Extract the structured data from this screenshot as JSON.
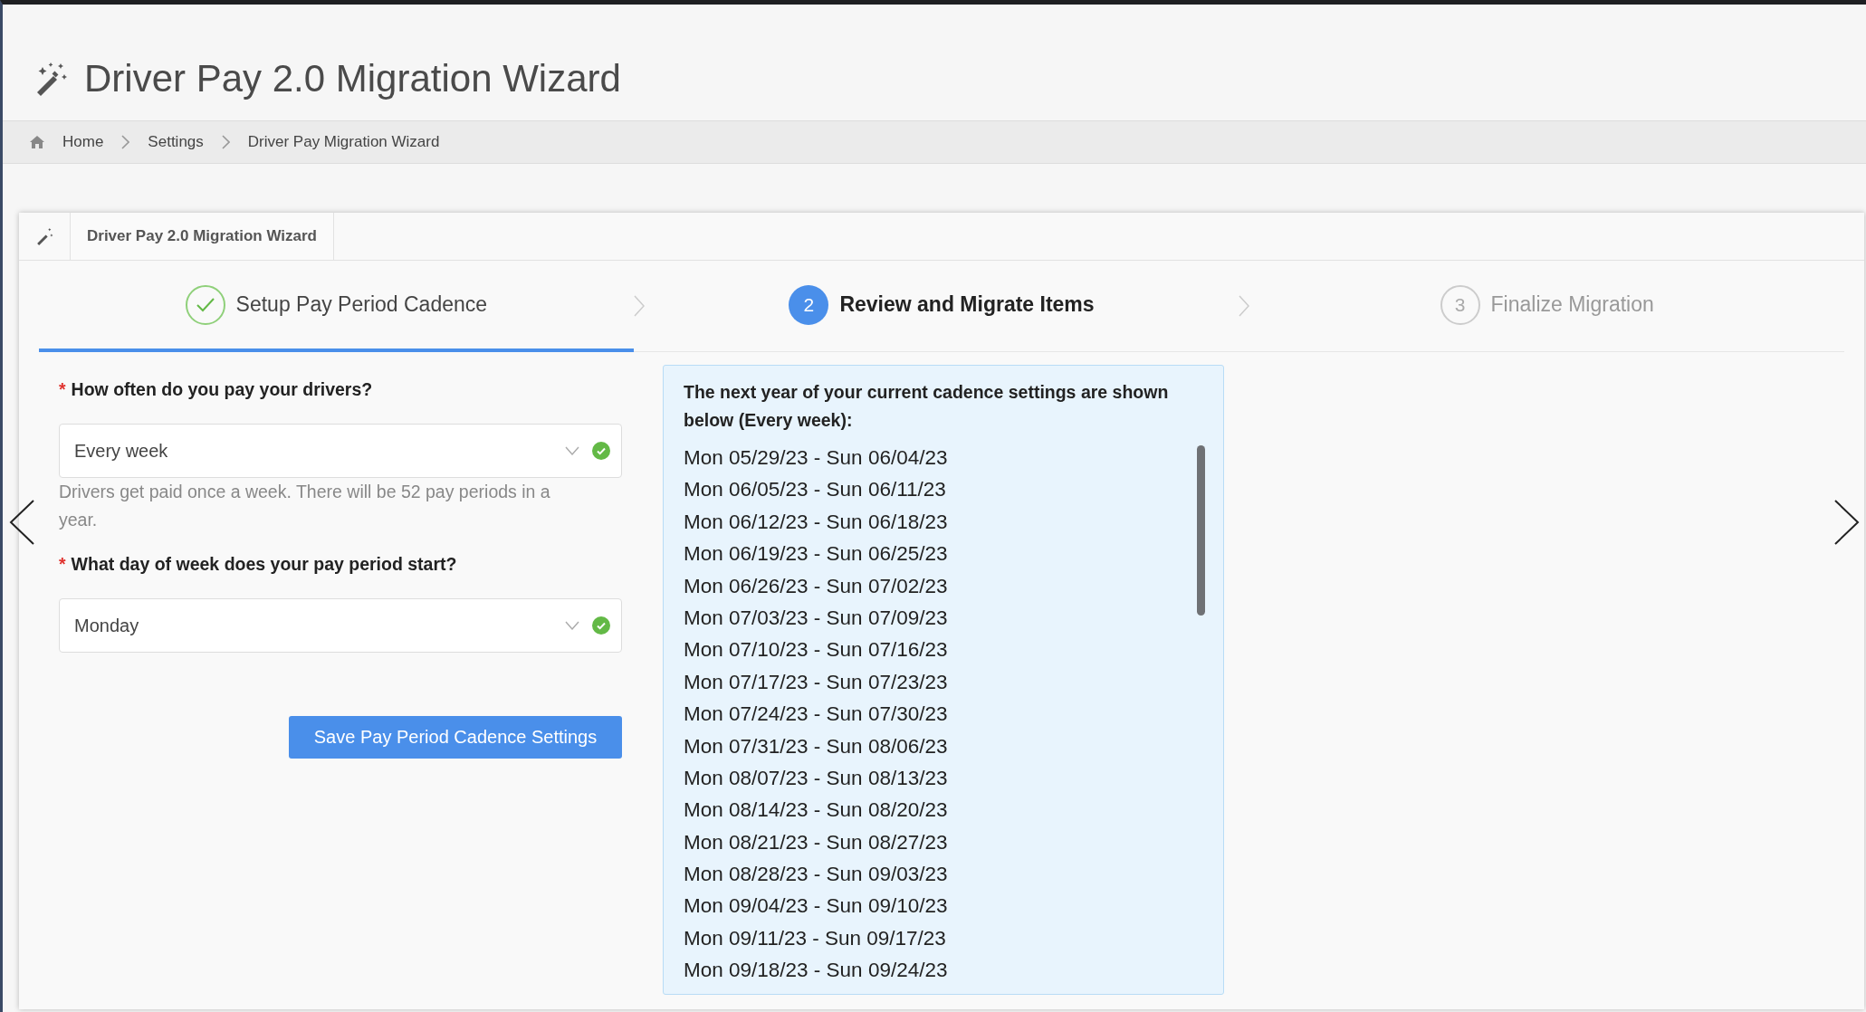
{
  "page_title": "Driver Pay 2.0 Migration Wizard",
  "breadcrumbs": [
    "Home",
    "Settings",
    "Driver Pay Migration Wizard"
  ],
  "card": {
    "tab_title": "Driver Pay 2.0 Migration Wizard"
  },
  "steps": [
    {
      "kind": "done",
      "label": "Setup Pay Period Cadence",
      "selected": true
    },
    {
      "kind": "current",
      "number": "2",
      "label": "Review and Migrate Items",
      "selected": false
    },
    {
      "kind": "pending",
      "number": "3",
      "label": "Finalize Migration",
      "selected": false
    }
  ],
  "form": {
    "fields": [
      {
        "label": "How often do you pay your drivers?",
        "required_mark": "*",
        "value": "Every week",
        "valid": true,
        "help": "Drivers get paid once a week. There will be 52 pay periods in a year."
      },
      {
        "label": "What day of week does your pay period start?",
        "required_mark": "*",
        "value": "Monday",
        "valid": true
      }
    ],
    "save_button": "Save Pay Period Cadence Settings"
  },
  "preview": {
    "heading": "The next year of your current cadence settings are shown below (Every week):",
    "periods": [
      "Mon 05/29/23 - Sun 06/04/23",
      "Mon 06/05/23 - Sun 06/11/23",
      "Mon 06/12/23 - Sun 06/18/23",
      "Mon 06/19/23 - Sun 06/25/23",
      "Mon 06/26/23 - Sun 07/02/23",
      "Mon 07/03/23 - Sun 07/09/23",
      "Mon 07/10/23 - Sun 07/16/23",
      "Mon 07/17/23 - Sun 07/23/23",
      "Mon 07/24/23 - Sun 07/30/23",
      "Mon 07/31/23 - Sun 08/06/23",
      "Mon 08/07/23 - Sun 08/13/23",
      "Mon 08/14/23 - Sun 08/20/23",
      "Mon 08/21/23 - Sun 08/27/23",
      "Mon 08/28/23 - Sun 09/03/23",
      "Mon 09/04/23 - Sun 09/10/23",
      "Mon 09/11/23 - Sun 09/17/23",
      "Mon 09/18/23 - Sun 09/24/23"
    ]
  }
}
